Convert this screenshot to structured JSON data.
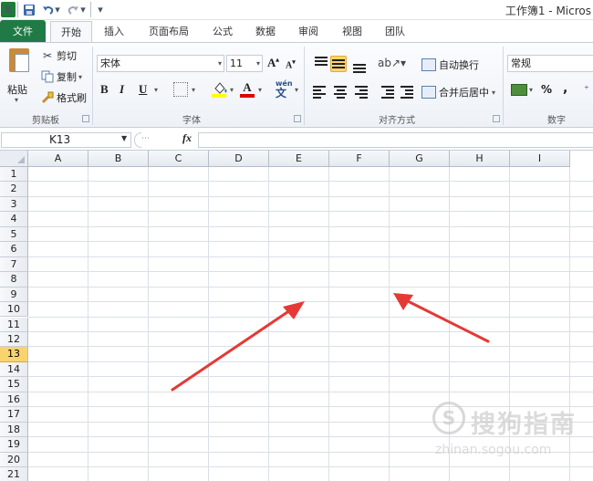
{
  "titlebar": {
    "app_icon": "X",
    "window_title": "工作簿1 - Micros",
    "icons": [
      "excel-app-icon",
      "save-icon",
      "undo-icon",
      "redo-icon",
      "customize-quick-access-icon"
    ]
  },
  "tabs": [
    {
      "label": "文件"
    },
    {
      "label": "开始"
    },
    {
      "label": "插入"
    },
    {
      "label": "页面布局"
    },
    {
      "label": "公式"
    },
    {
      "label": "数据"
    },
    {
      "label": "审阅"
    },
    {
      "label": "视图"
    },
    {
      "label": "团队"
    }
  ],
  "ribbon": {
    "clipboard": {
      "paste": "粘贴",
      "cut": "剪切",
      "copy": "复制",
      "painter": "格式刷",
      "group_label": "剪贴板"
    },
    "font": {
      "font_name": "宋体",
      "font_size": "11",
      "bold": "B",
      "italic": "I",
      "underline": "U",
      "font_color_letter": "A",
      "grow": "A",
      "shrink": "A",
      "phonetic": "wén",
      "group_label": "字体",
      "fill_color": "#ffff00",
      "font_color": "#e00000"
    },
    "alignment": {
      "wrap": "自动换行",
      "merge": "合并后居中",
      "group_label": "对齐方式"
    },
    "number": {
      "format": "常规",
      "percent": "%",
      "comma": ",",
      "group_label": "数字"
    }
  },
  "formula_bar": {
    "name_box": "K13",
    "fx": "fx",
    "formula": ""
  },
  "grid": {
    "columns": [
      "A",
      "B",
      "C",
      "D",
      "E",
      "F",
      "G",
      "H",
      "I"
    ],
    "rows": [
      "1",
      "2",
      "3",
      "4",
      "5",
      "6",
      "7",
      "8",
      "9",
      "10",
      "11",
      "12",
      "13",
      "14",
      "15",
      "16",
      "17",
      "18",
      "19",
      "20",
      "21"
    ],
    "active_row": "13",
    "selection_color": "#f9d36c"
  },
  "annotations": {
    "arrow_color": "#e53935"
  },
  "watermark": {
    "brand": "搜狗指南",
    "url": "zhinan.sogou.com"
  }
}
